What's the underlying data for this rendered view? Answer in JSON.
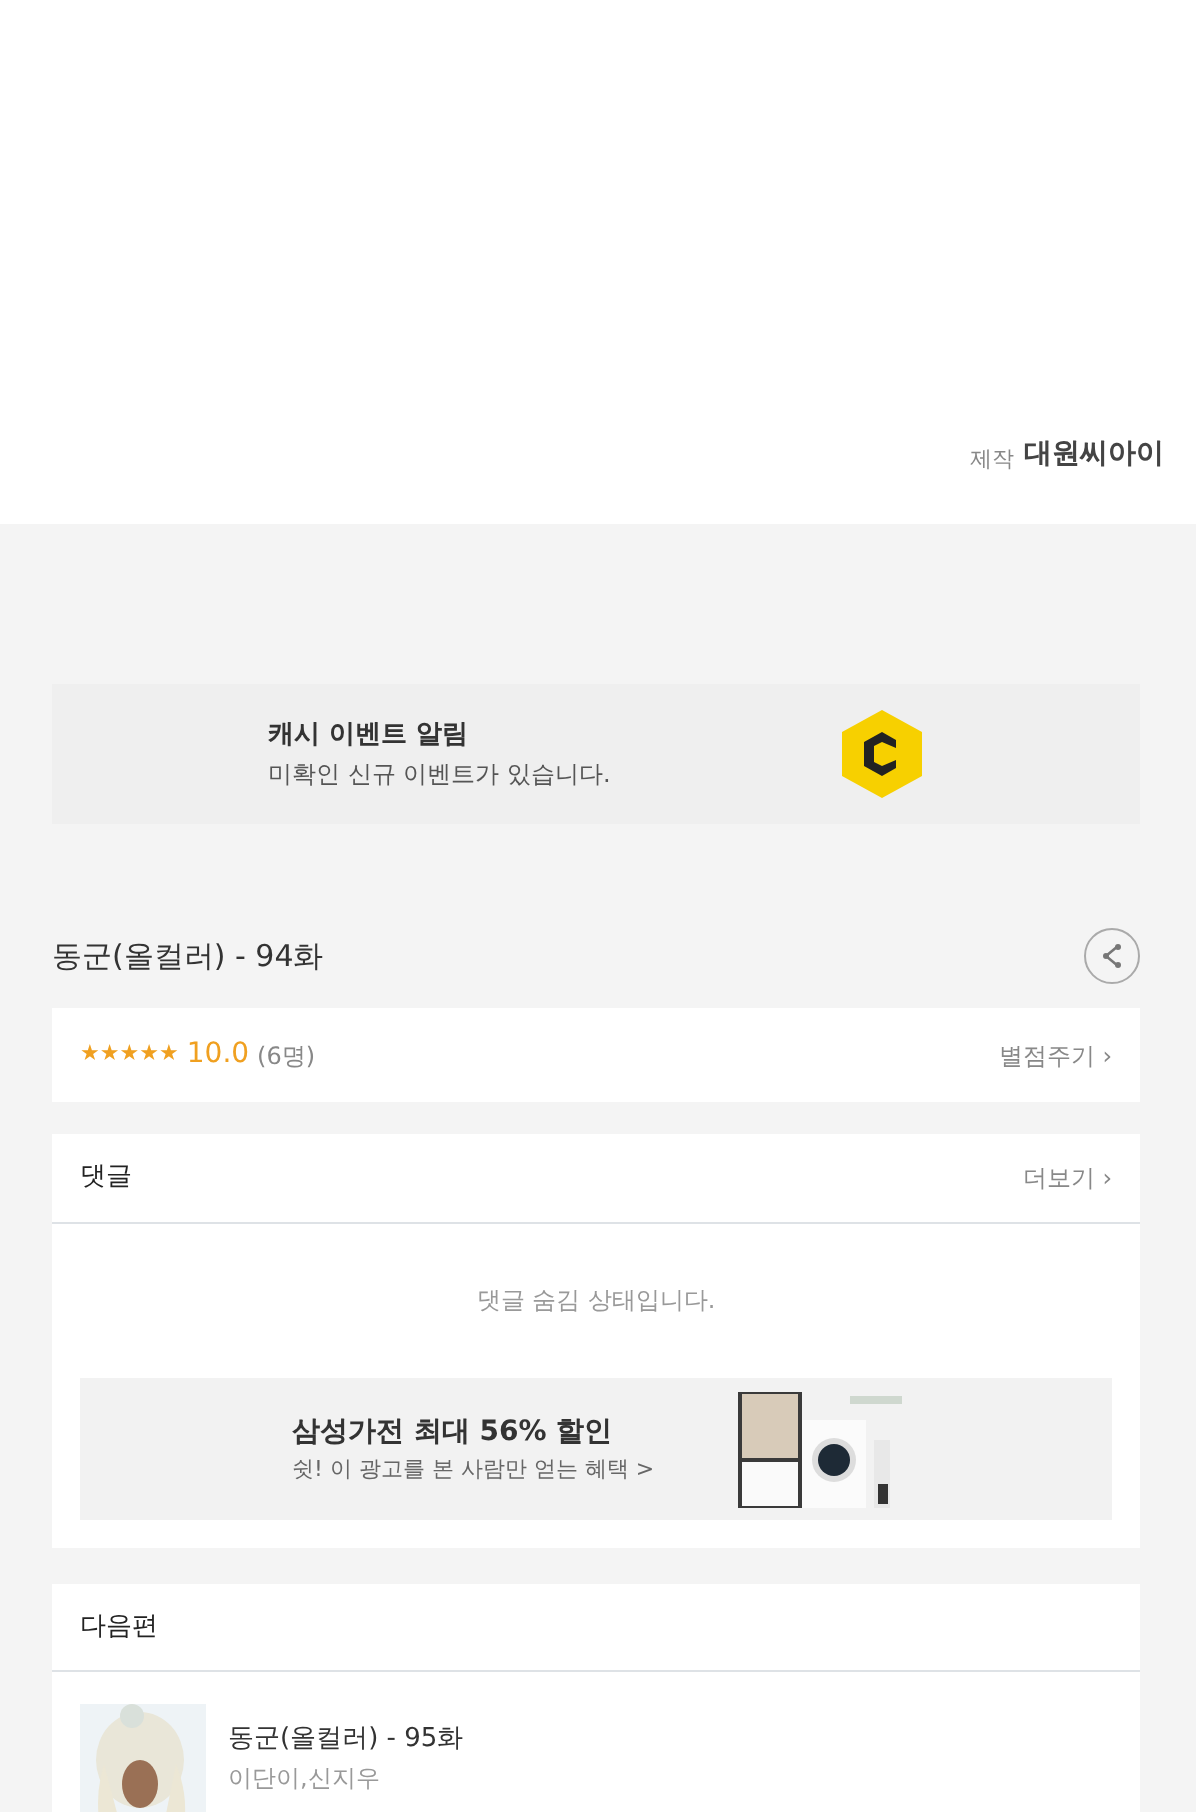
{
  "credit": {
    "label": "제작",
    "name": "대원씨아이"
  },
  "event_banner": {
    "title": "캐시 이벤트 알림",
    "subtitle": "미확인 신규 이벤트가 있습니다."
  },
  "episode": {
    "title": "동군(올컬러) - 94화"
  },
  "rating": {
    "stars": 5,
    "score": "10.0",
    "count": "(6명)",
    "action": "별점주기",
    "action_arrow": "›"
  },
  "comments": {
    "heading": "댓글",
    "more": "더보기",
    "more_arrow": "›",
    "notice": "댓글 숨김 상태입니다.",
    "ad": {
      "title": "삼성가전 최대 56% 할인",
      "subtitle": "쉿! 이 광고를 본 사람만 얻는 혜택 >"
    }
  },
  "next": {
    "heading": "다음편",
    "items": [
      {
        "title": "동군(올컬러) - 95화",
        "authors": "이단이,신지우"
      }
    ]
  }
}
